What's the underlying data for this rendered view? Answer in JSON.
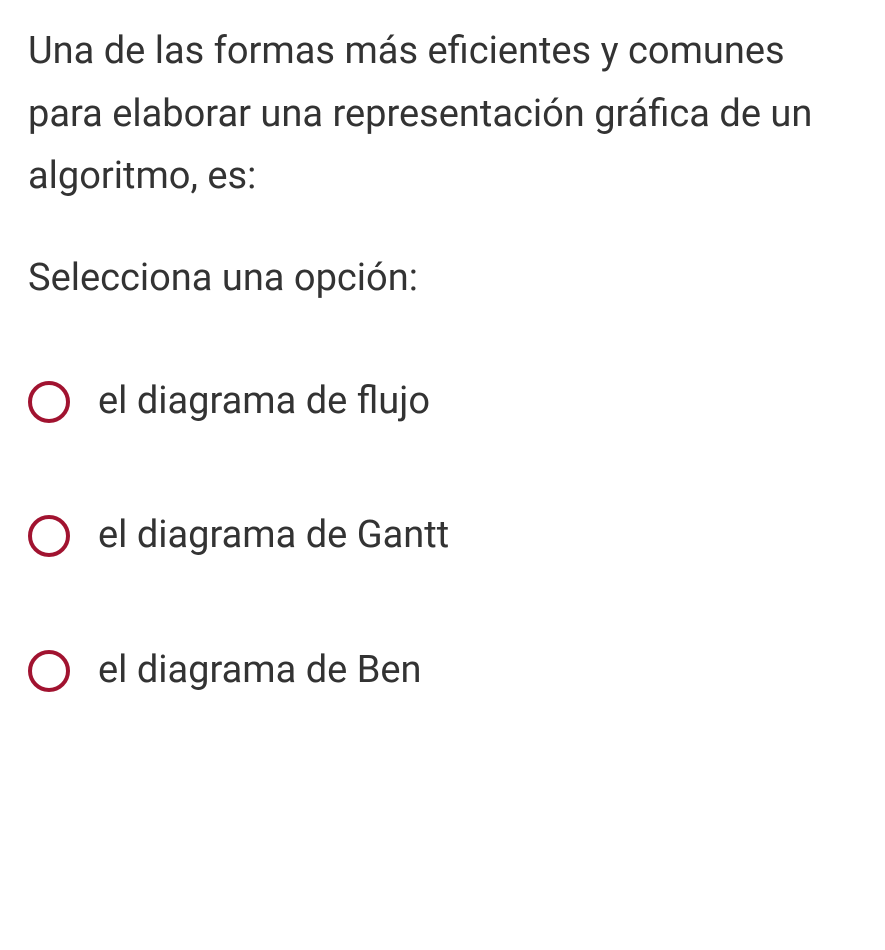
{
  "question": {
    "text": "Una de las formas más eficientes y comunes para elaborar una representación gráfica de un algoritmo, es:",
    "instruction": "Selecciona una opción:"
  },
  "options": [
    {
      "label": "el diagrama de flujo"
    },
    {
      "label": "el diagrama de Gantt"
    },
    {
      "label": "el diagrama de Ben"
    }
  ],
  "colors": {
    "radio_border": "#a11330",
    "text": "#333333"
  }
}
